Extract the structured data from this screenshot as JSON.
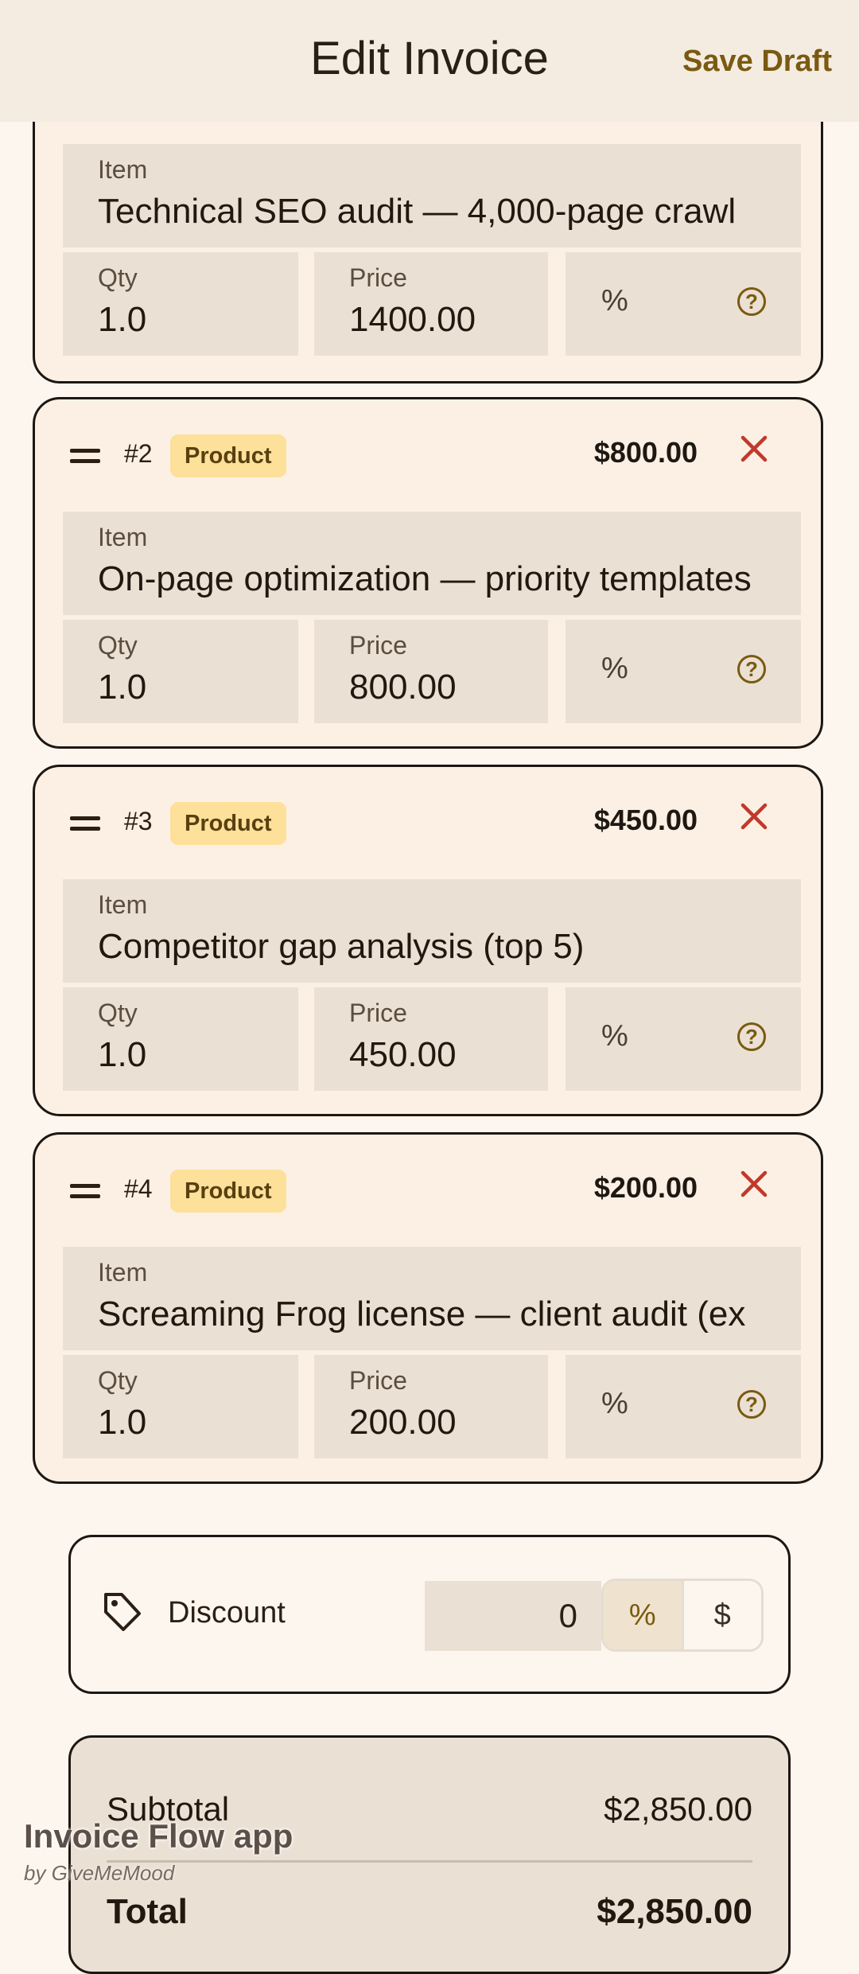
{
  "appbar": {
    "title": "Edit Invoice",
    "save_label": "Save Draft"
  },
  "labels": {
    "item": "Item",
    "qty": "Qty",
    "price": "Price",
    "percent": "%"
  },
  "items": [
    {
      "number": "",
      "type": "",
      "amount": "",
      "name": "Technical SEO audit — 4,000-page crawl",
      "qty": "1.0",
      "price": "1400.00"
    },
    {
      "number": "#2",
      "type": "Product",
      "amount": "$800.00",
      "name": "On-page optimization — priority templates",
      "qty": "1.0",
      "price": "800.00"
    },
    {
      "number": "#3",
      "type": "Product",
      "amount": "$450.00",
      "name": "Competitor gap analysis (top 5)",
      "qty": "1.0",
      "price": "450.00"
    },
    {
      "number": "#4",
      "type": "Product",
      "amount": "$200.00",
      "name": "Screaming Frog license — client audit (ex",
      "qty": "1.0",
      "price": "200.00"
    }
  ],
  "discount": {
    "label": "Discount",
    "value": "0",
    "mode_percent": "%",
    "mode_dollar": "$"
  },
  "totals": {
    "subtotal_label": "Subtotal",
    "subtotal_value": "$2,850.00",
    "total_label": "Total",
    "total_value": "$2,850.00"
  },
  "watermark": {
    "title": "Invoice Flow app",
    "subtitle": "by GiveMeMood"
  },
  "colors": {
    "accent": "#7a5a10",
    "badge_bg": "#fde09a",
    "remove": "#c0392b",
    "card_bg": "#fcf0e4",
    "field_bg": "#ebe0d4"
  }
}
